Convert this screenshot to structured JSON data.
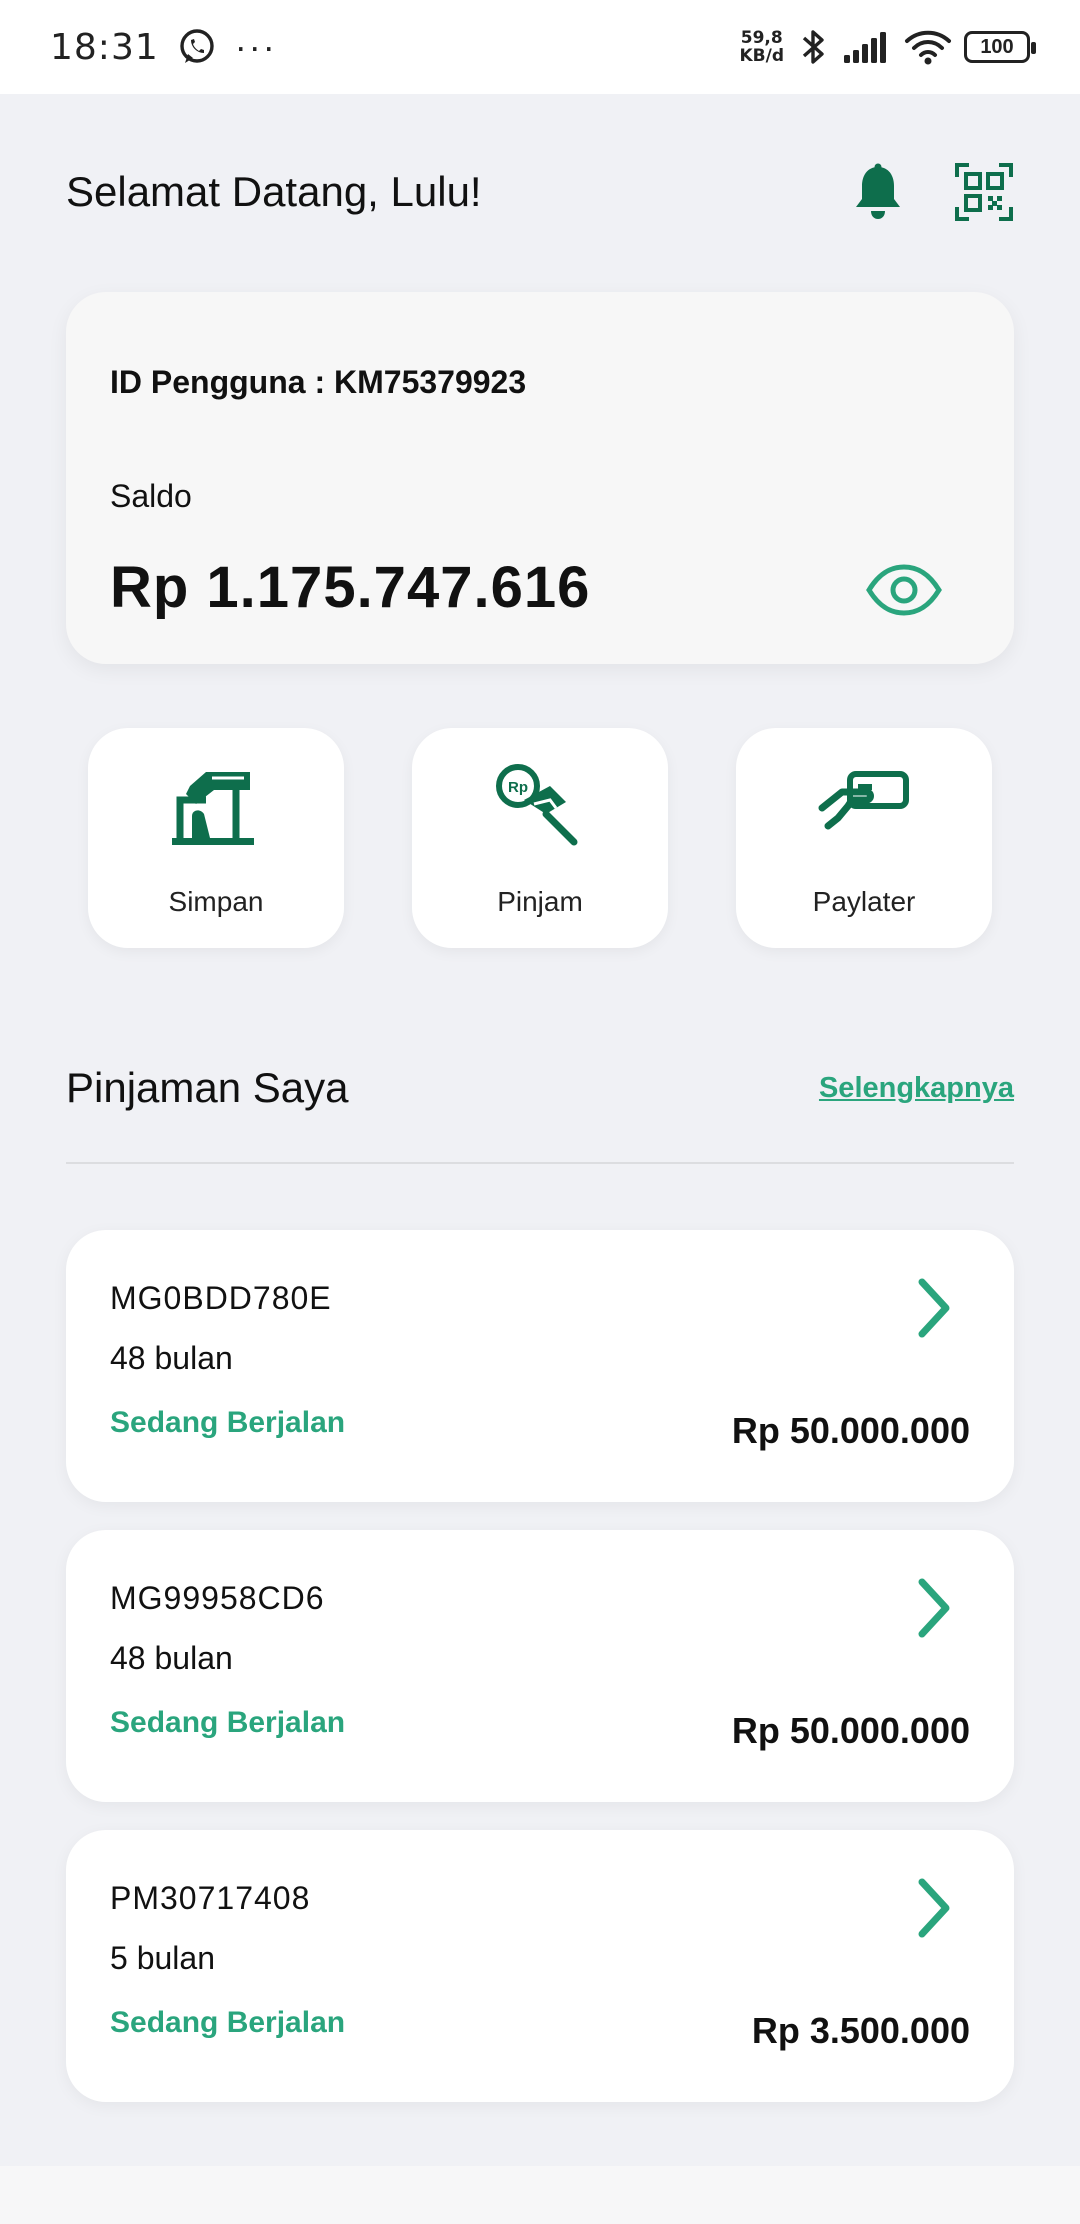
{
  "status_bar": {
    "time": "18:31",
    "more": "···",
    "net_speed_value": "59,8",
    "net_speed_unit": "KB/d",
    "battery": "100"
  },
  "header": {
    "greeting": "Selamat Datang, Lulu!"
  },
  "balance": {
    "user_id": "ID Pengguna : KM75379923",
    "saldo_label": "Saldo",
    "saldo_value": "Rp 1.175.747.616"
  },
  "menu": [
    {
      "label": "Simpan",
      "icon": "savings-icon"
    },
    {
      "label": "Pinjam",
      "icon": "loan-icon"
    },
    {
      "label": "Paylater",
      "icon": "paylater-icon"
    }
  ],
  "loans_section": {
    "title": "Pinjaman Saya",
    "see_more": "Selengkapnya"
  },
  "loans": [
    {
      "id": "MG0BDD780E",
      "tenor": "48 bulan",
      "status": "Sedang Berjalan",
      "amount": "Rp 50.000.000"
    },
    {
      "id": "MG99958CD6",
      "tenor": "48 bulan",
      "status": "Sedang Berjalan",
      "amount": "Rp 50.000.000"
    },
    {
      "id": "PM30717408",
      "tenor": "5 bulan",
      "status": "Sedang Berjalan",
      "amount": "Rp 3.500.000"
    }
  ],
  "colors": {
    "primary_dark": "#0e6e4c",
    "accent": "#2aa57d",
    "background": "#f0f1f5"
  }
}
